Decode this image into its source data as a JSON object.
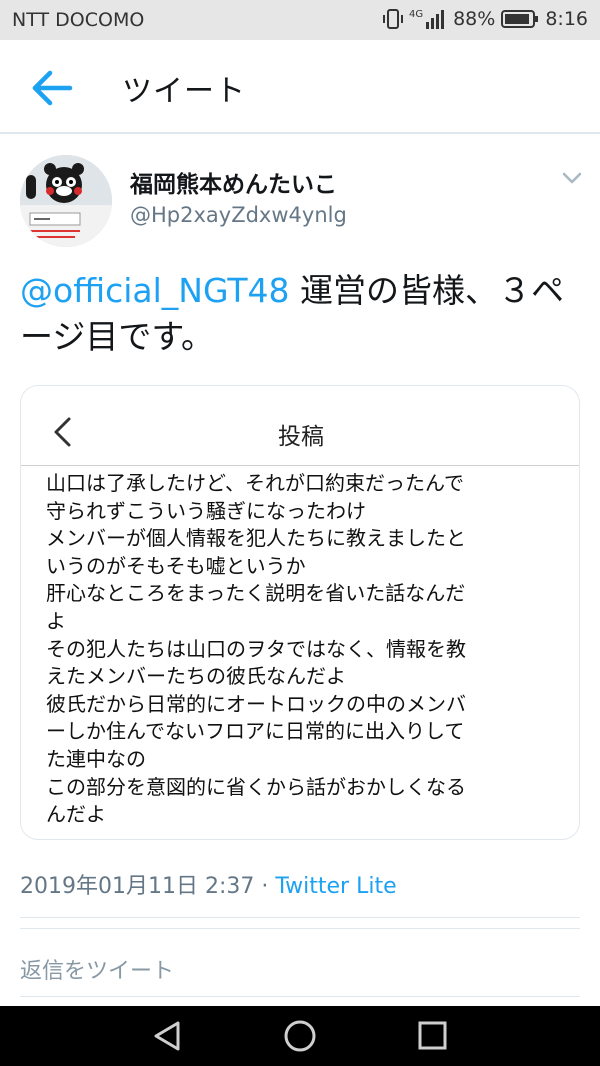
{
  "status_bar": {
    "carrier": "NTT DOCOMO",
    "network": "4G",
    "battery": "88%",
    "time": "8:16"
  },
  "header": {
    "title": "ツイート",
    "back_icon": "arrow-left-icon"
  },
  "tweet": {
    "author_name": "福岡熊本めんたいこ",
    "author_handle": "@Hp2xayZdxw4ynlg",
    "mention": "@official_NGT48",
    "text": " 運営の皆様、３ページ目です。",
    "timestamp": "2019年01月11日 2:37 · ",
    "source": "Twitter Lite",
    "accent_color": "#1da1f2"
  },
  "media": {
    "inner_title": "投稿",
    "inner_body": "山口は了承したけど、それが口約束だったんで\n守られずこういう騒ぎになったわけ\nメンバーが個人情報を犯人たちに教えましたと\nいうのがそもそも嘘というか\n肝心なところをまったく説明を省いた話なんだ\nよ\nその犯人たちは山口のヲタではなく、情報を教\nえたメンバーたちの彼氏なんだよ\n彼氏だから日常的にオートロックの中のメンバ\nーしか住んでないフロアに日常的に出入りして\nた連中なの\nこの部分を意図的に省くから話がおかしくなる\nんだよ"
  },
  "reply": {
    "placeholder": "返信をツイート"
  }
}
